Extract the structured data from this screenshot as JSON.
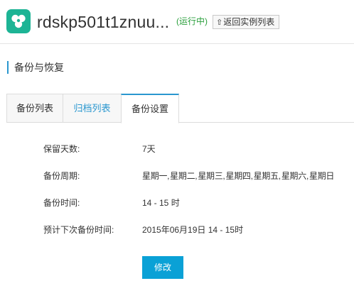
{
  "header": {
    "logo_icon": "database-logo-icon",
    "instance_name": "rdskp501t1znuu...",
    "status": "(运行中)",
    "back_button_label": "返回实例列表",
    "back_icon": "arrow-up-icon"
  },
  "section": {
    "title": "备份与恢复"
  },
  "tabs": [
    {
      "label": "备份列表",
      "active": false
    },
    {
      "label": "归档列表",
      "active": false
    },
    {
      "label": "备份设置",
      "active": true
    }
  ],
  "settings": {
    "retention_label": "保留天数:",
    "retention_value": "7天",
    "cycle_label": "备份周期:",
    "cycle_value": "星期一, 星期二, 星期三, 星期四, 星期五, 星期六, 星期日",
    "time_label": "备份时间:",
    "time_value": "14 - 15 时",
    "next_label": "预计下次备份时间:",
    "next_value": "2015年06月19日 14 - 15时"
  },
  "actions": {
    "edit_label": "修改"
  },
  "colors": {
    "accent": "#2a97cf",
    "primary_button": "#0aa1d6",
    "logo_bg": "#1db495",
    "status_green": "#2a9f3c"
  }
}
